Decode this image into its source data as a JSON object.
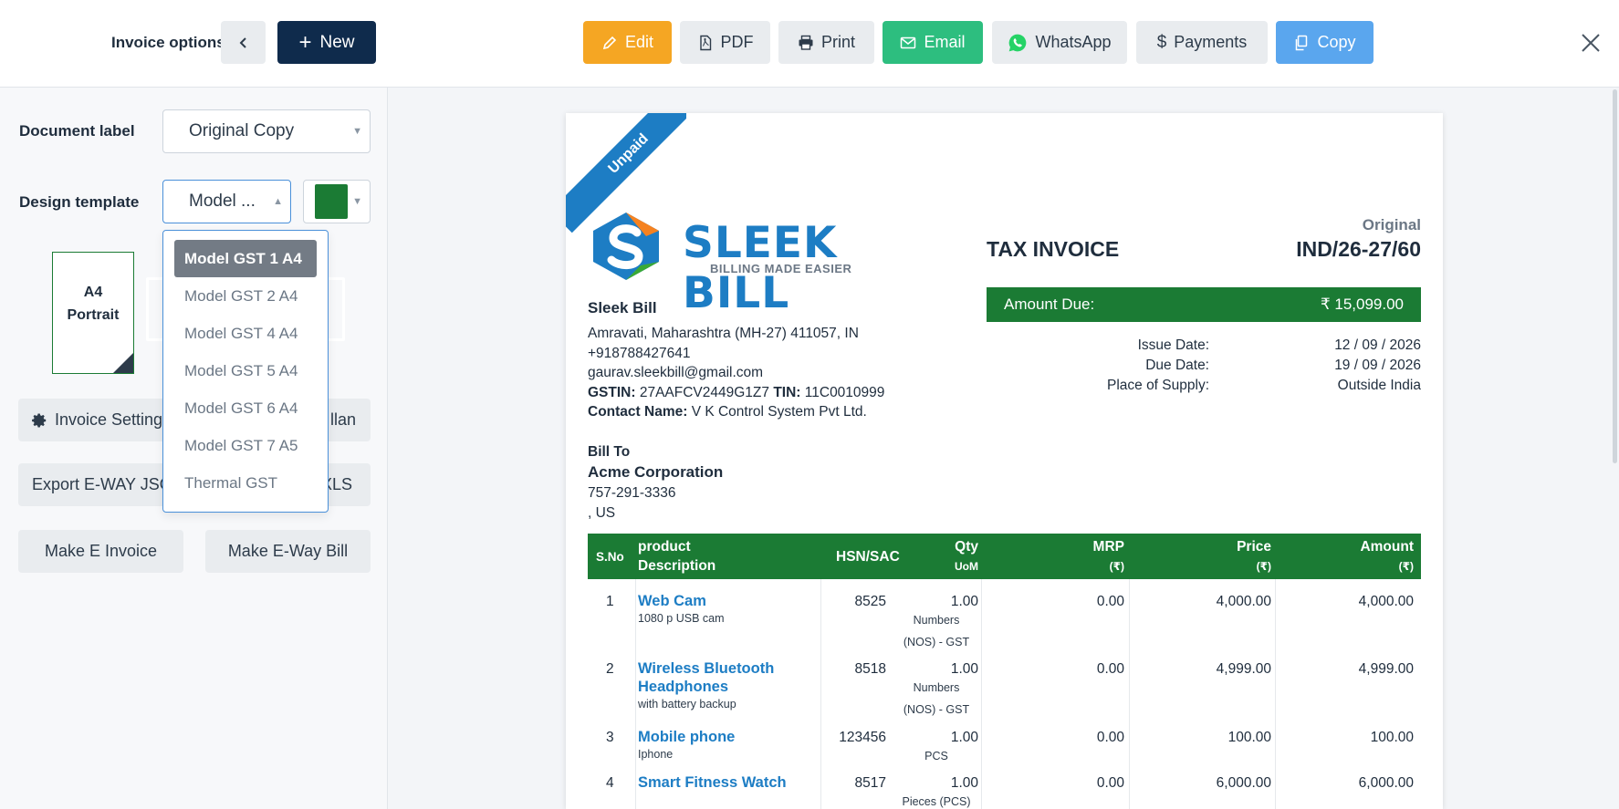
{
  "left_panel": {
    "title": "Invoice options",
    "back_icon": "‹",
    "new_label": "New",
    "document_label": {
      "label": "Document label",
      "value": "Original Copy"
    },
    "design_template": {
      "label": "Design template",
      "value": "Model ...",
      "color": "#1b7b34"
    },
    "orientation_portrait": {
      "line1": "A4",
      "line2": "Portrait"
    },
    "dropdown_options": [
      "Model GST 1 A4",
      "Model GST 2 A4",
      "Model GST 4 A4",
      "Model GST 5 A4",
      "Model GST 6 A4",
      "Model GST 7 A5",
      "Thermal GST"
    ],
    "selected_option": "Model GST 1 A4",
    "invoice_settings_label": "Invoice Settings",
    "invoice_settings_right": "llan",
    "export_eway_label": "Export E-WAY JSON",
    "export_eway_right": "XLS",
    "make_einvoice_label": "Make E Invoice",
    "make_ewaybill_label": "Make E-Way Bill"
  },
  "toolbar": {
    "edit": "Edit",
    "pdf": "PDF",
    "print": "Print",
    "email": "Email",
    "whatsapp": "WhatsApp",
    "payments": "Payments",
    "copy": "Copy"
  },
  "invoice": {
    "status_ribbon": "Unpaid",
    "logo_text": "SLEEK BILL",
    "logo_tagline": "BILLING MADE EASIER",
    "copy_label": "Original",
    "title": "TAX INVOICE",
    "number": "IND/26-27/60",
    "amount_due_label": "Amount Due:",
    "amount_due_value": "₹ 15,099.00",
    "issue_date_label": "Issue Date:",
    "issue_date": "12 / 09 / 2026",
    "due_date_label": "Due Date:",
    "due_date": "19 / 09 / 2026",
    "place_label": "Place of Supply:",
    "place": "Outside India",
    "seller": {
      "name": "Sleek Bill",
      "address": "Amravati, Maharashtra (MH-27) 411057, IN",
      "phone": "+918788427641",
      "email": "gaurav.sleekbill@gmail.com",
      "gstin_label": "GSTIN:",
      "gstin": "27AAFCV2449G1Z7",
      "tin_label": "TIN:",
      "tin": "11C0010999",
      "contact_label": "Contact Name:",
      "contact": "V K Control System Pvt Ltd."
    },
    "bill_to": {
      "label": "Bill To",
      "name": "Acme Corporation",
      "phone": "757-291-3336",
      "address": ", US"
    },
    "table": {
      "h_sno": "S.No",
      "h_product": "product",
      "h_desc": "Description",
      "h_hsn": "HSN/SAC",
      "h_qty": "Qty",
      "h_uom": "UoM",
      "h_mrp": "MRP",
      "h_price": "Price",
      "h_amount": "Amount",
      "h_currency": "(₹)",
      "rows": [
        {
          "sno": "1",
          "name": "Web Cam",
          "desc": "1080 p USB cam",
          "hsn": "8525",
          "qty": "1.00",
          "uom1": "Numbers",
          "uom2": "(NOS) - GST",
          "mrp": "0.00",
          "price": "4,000.00",
          "amount": "4,000.00"
        },
        {
          "sno": "2",
          "name": "Wireless Bluetooth",
          "name2": "Headphones",
          "desc": "with battery backup",
          "hsn": "8518",
          "qty": "1.00",
          "uom1": "Numbers",
          "uom2": "(NOS) - GST",
          "mrp": "0.00",
          "price": "4,999.00",
          "amount": "4,999.00"
        },
        {
          "sno": "3",
          "name": "Mobile phone",
          "desc": "Iphone",
          "hsn": "123456",
          "qty": "1.00",
          "uom1": "PCS",
          "mrp": "0.00",
          "price": "100.00",
          "amount": "100.00"
        },
        {
          "sno": "4",
          "name": "Smart Fitness Watch",
          "desc": "",
          "hsn": "8517",
          "qty": "1.00",
          "uom1": "Pieces (PCS)",
          "mrp": "0.00",
          "price": "6,000.00",
          "amount": "6,000.00"
        }
      ]
    }
  }
}
